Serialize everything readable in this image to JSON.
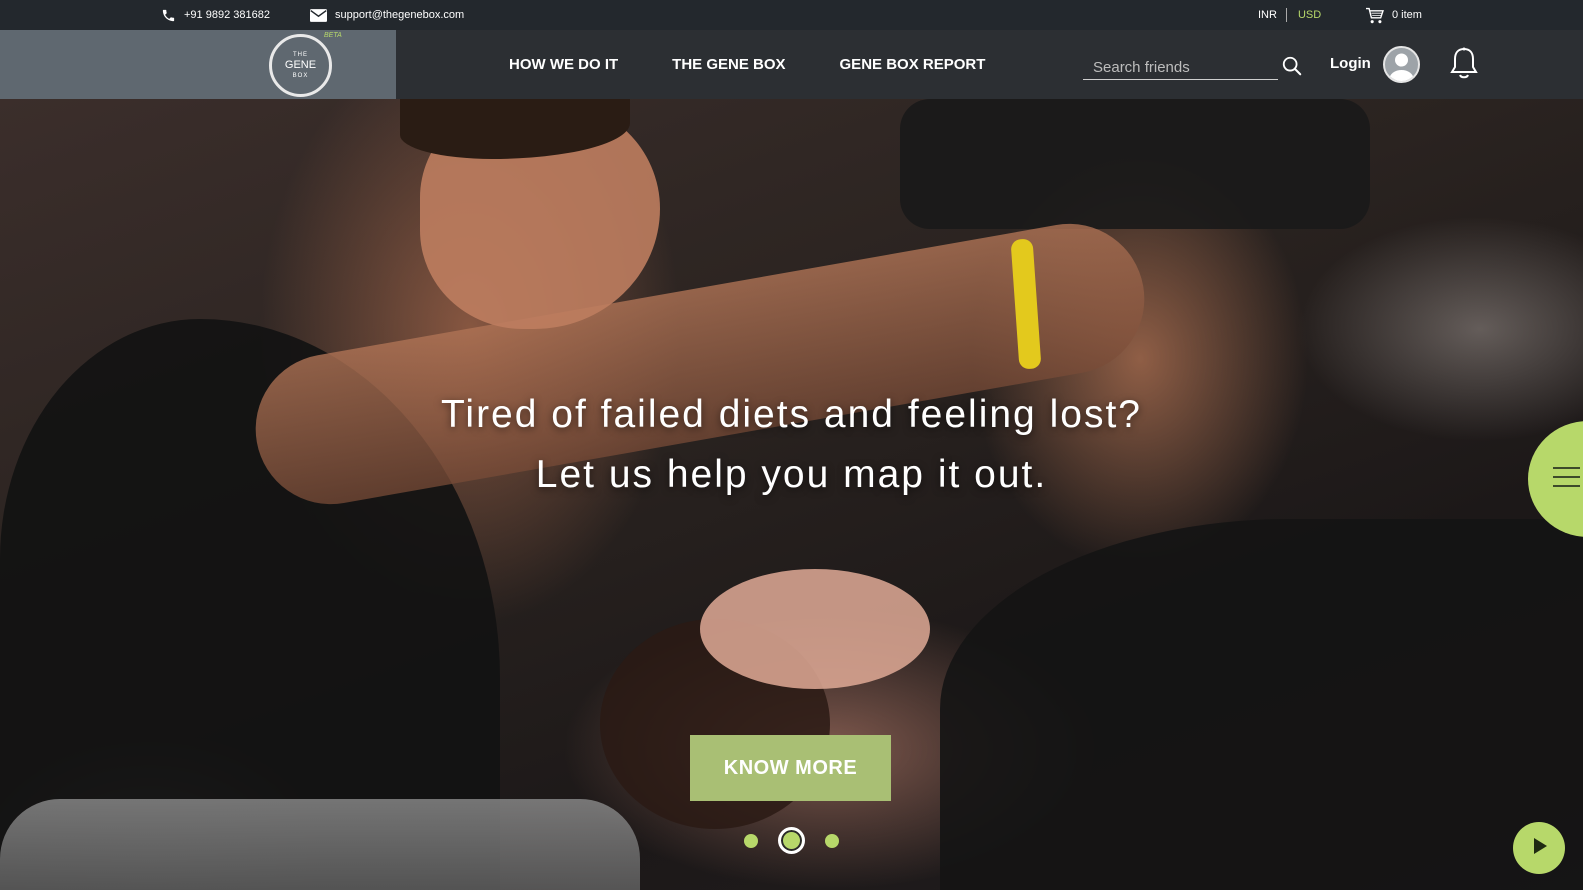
{
  "topbar": {
    "phone": "+91 9892 381682",
    "email": "support@thegenebox.com",
    "currency_inr": "INR",
    "currency_usd": "USD",
    "cart": "0 item"
  },
  "logo": {
    "the": "THE",
    "gene": "GENE",
    "box": "BOX",
    "beta": "BETA"
  },
  "nav": {
    "links": [
      "HOW WE DO IT",
      "THE GENE BOX",
      "GENE BOX REPORT"
    ],
    "search_placeholder": "Search friends",
    "login": "Login"
  },
  "hero": {
    "line1": "Tired of failed diets and feeling lost?",
    "line2": "Let us help you map it out.",
    "cta": "KNOW MORE",
    "slides": 3,
    "active_slide": 2
  },
  "colors": {
    "accent": "#b7d86a",
    "cta": "#a9bf74",
    "topbar": "#23282d",
    "navbar": "#2c2f33"
  },
  "icons": [
    "phone-icon",
    "mail-icon",
    "cart-icon",
    "search-icon",
    "avatar-icon",
    "bell-icon",
    "menu-icon",
    "play-icon"
  ]
}
